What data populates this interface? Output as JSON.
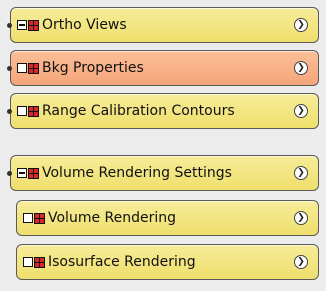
{
  "panels": [
    {
      "label": "Ortho Views",
      "expanded": true,
      "color": "#efdf6c"
    },
    {
      "label": "Bkg Properties",
      "expanded": false,
      "color": "#f6a57a"
    },
    {
      "label": "Range Calibration Contours",
      "expanded": false,
      "color": "#efdf6c"
    },
    {
      "label": "Volume Rendering Settings",
      "expanded": true,
      "color": "#efdf6c"
    },
    {
      "label": "Volume Rendering",
      "expanded": false,
      "color": "#efdf6c"
    },
    {
      "label": "Isosurface Rendering",
      "expanded": false,
      "color": "#efdf6c"
    }
  ],
  "icons": {
    "expand": "chevron-right-circle-icon",
    "collapse_box": "minus-box-icon",
    "empty_box": "checkbox-icon",
    "grid": "grid-icon"
  }
}
